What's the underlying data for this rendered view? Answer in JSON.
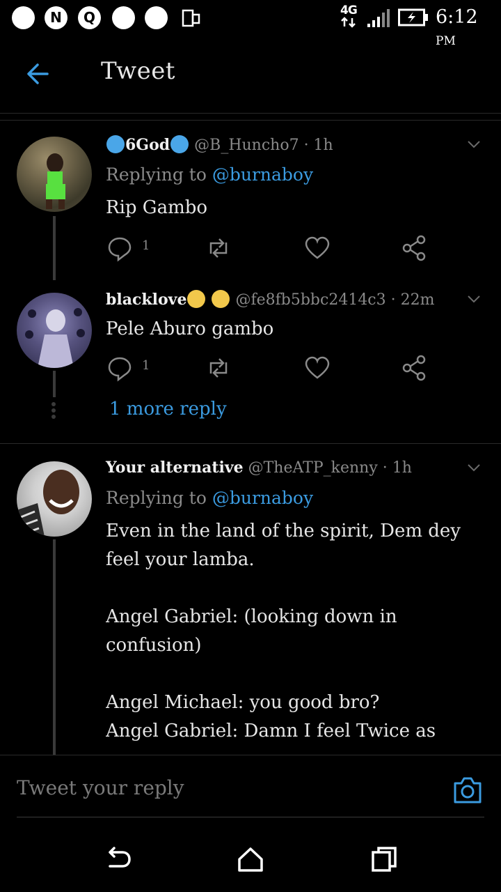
{
  "status_bar": {
    "icons": [
      "circle-icon",
      "n-icon",
      "record-icon",
      "circle-icon",
      "circle-icon",
      "phone-icon"
    ],
    "network": "4G",
    "time": "6:12",
    "ampm": "PM"
  },
  "header": {
    "title": "Tweet"
  },
  "tweets": [
    {
      "name": "6God",
      "handle": "@B_Huncho7 · 1h",
      "replying_prefix": "Replying to ",
      "replying_to": "@burnaboy",
      "text": "Rip Gambo",
      "reply_count": "1"
    },
    {
      "name": "blacklove",
      "handle": "@fe8fb5bbc2414c3 · 22m",
      "text": "Pele Aburo gambo",
      "reply_count": "1"
    },
    {
      "name": "Your alternative",
      "handle": "@TheATP_kenny · 1h",
      "replying_prefix": "Replying to ",
      "replying_to": "@burnaboy",
      "text": "Even in the land of the spirit, Dem dey feel your lamba.\n\nAngel Gabriel: (looking down in confusion)\n\nAngel Michael: you good bro?\nAngel Gabriel: Damn I feel Twice as"
    }
  ],
  "more_reply": "1 more reply",
  "reply_bar": {
    "placeholder": "Tweet your reply"
  },
  "colors": {
    "accent": "#3b9be0",
    "background": "#000000",
    "muted": "#8a8a8a"
  },
  "nav": {
    "icons": [
      "back-nav-icon",
      "home-nav-icon",
      "recents-nav-icon"
    ]
  }
}
